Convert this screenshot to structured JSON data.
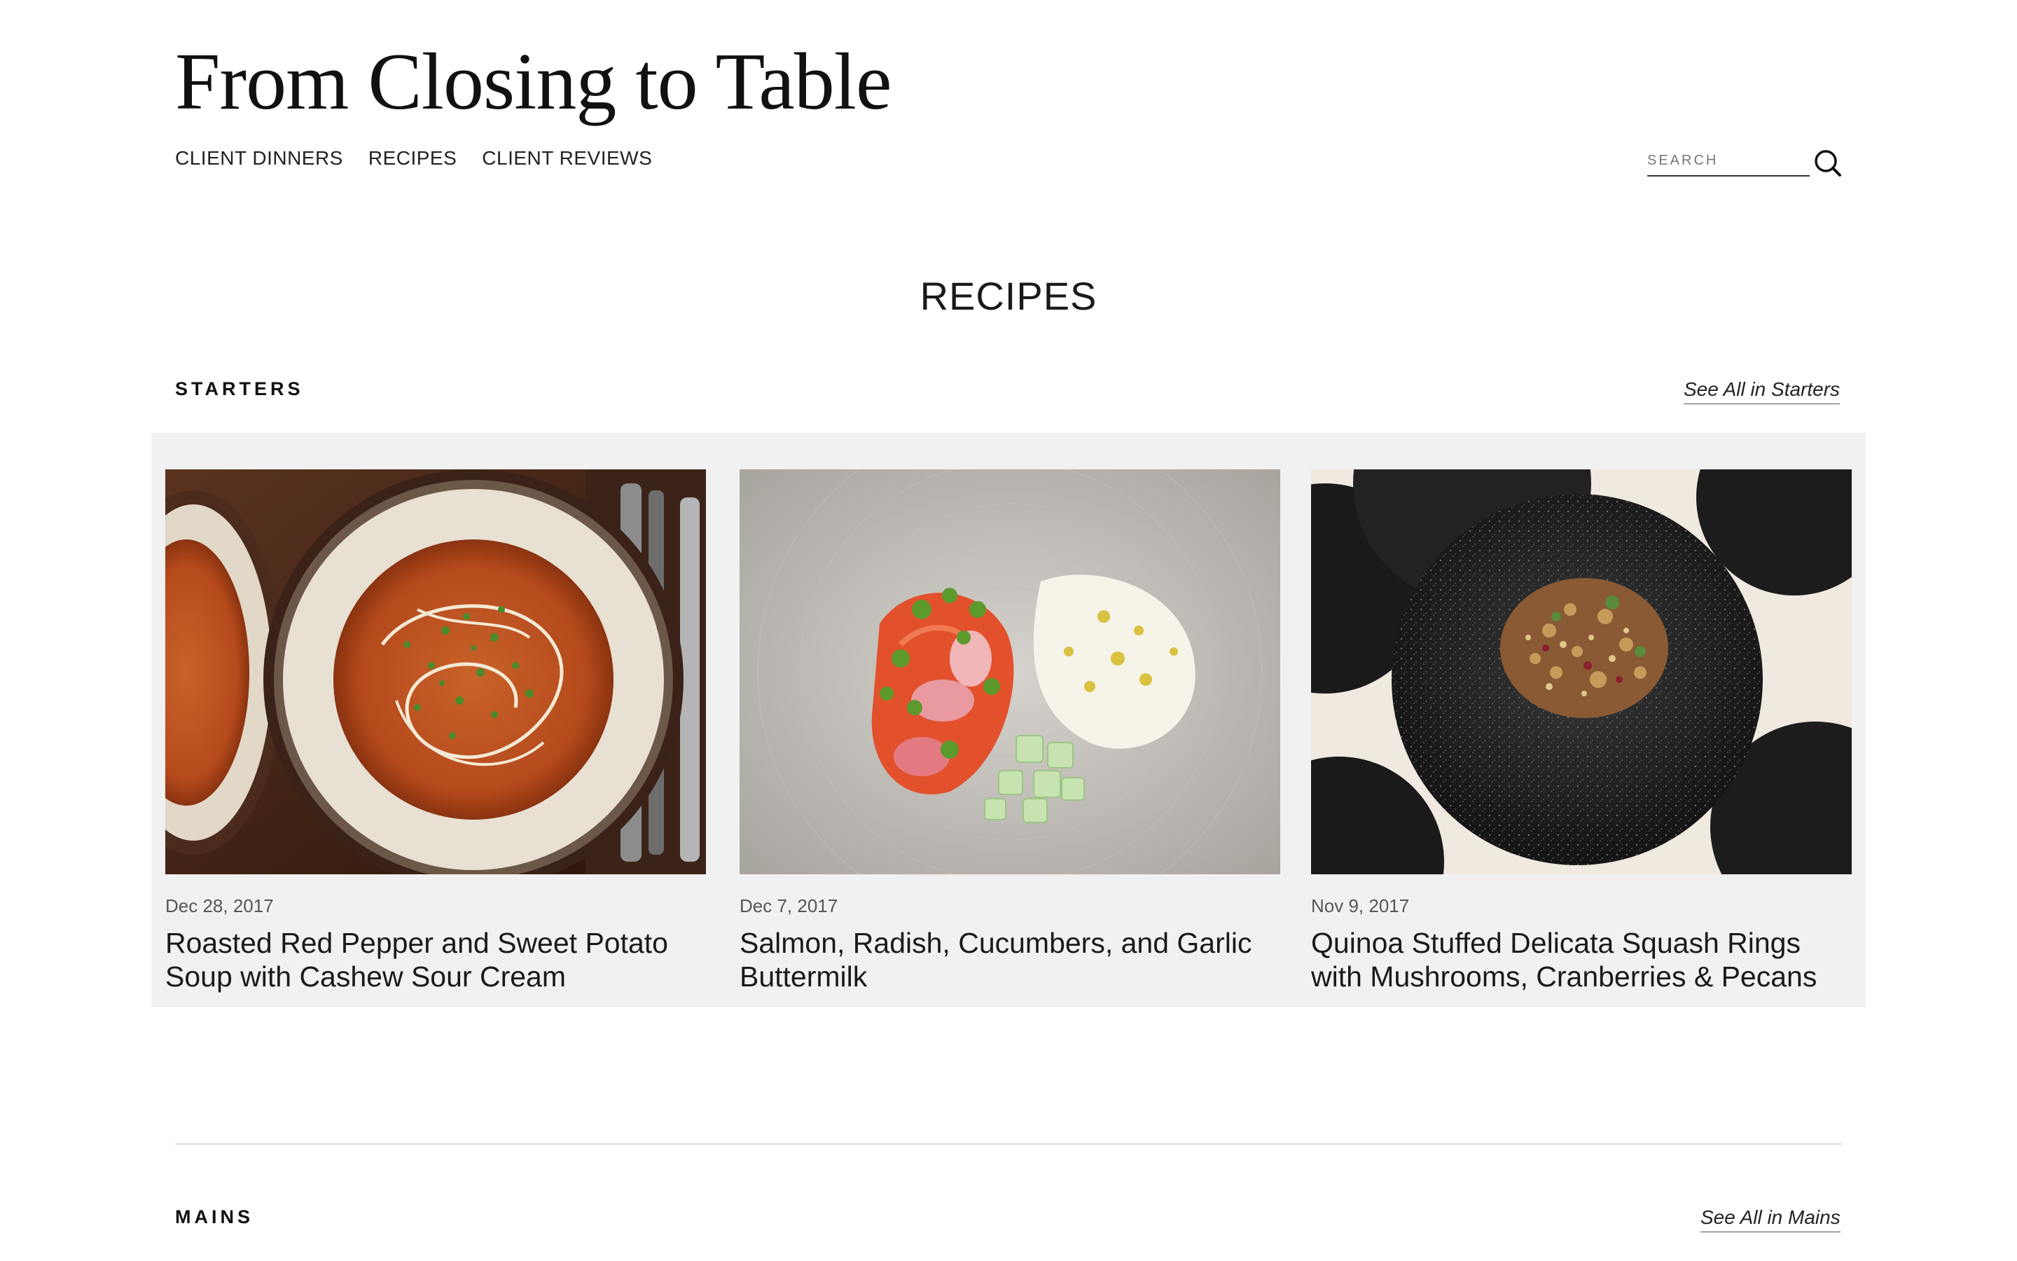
{
  "site": {
    "title": "From Closing to Table"
  },
  "nav": {
    "items": [
      {
        "label": "CLIENT DINNERS"
      },
      {
        "label": "RECIPES"
      },
      {
        "label": "CLIENT REVIEWS"
      }
    ]
  },
  "search": {
    "placeholder": "SEARCH",
    "icon": "search-icon"
  },
  "page": {
    "heading": "RECIPES"
  },
  "sections": [
    {
      "label": "STARTERS",
      "see_all": "See All in Starters",
      "cards": [
        {
          "date": "Dec 28, 2017",
          "title": "Roasted Red Pepper and Sweet Potato Soup with Cashew Sour Cream"
        },
        {
          "date": "Dec 7, 2017",
          "title": "Salmon, Radish, Cucumbers, and Garlic Buttermilk"
        },
        {
          "date": "Nov 9, 2017",
          "title": "Quinoa Stuffed Delicata Squash Rings with Mushrooms, Cranberries & Pecans"
        }
      ]
    },
    {
      "label": "MAINS",
      "see_all": "See All in Mains"
    }
  ],
  "colors": {
    "panel_bg": "#f1f1f1",
    "text": "#1a1a1a",
    "divider": "#dcdcdc"
  }
}
